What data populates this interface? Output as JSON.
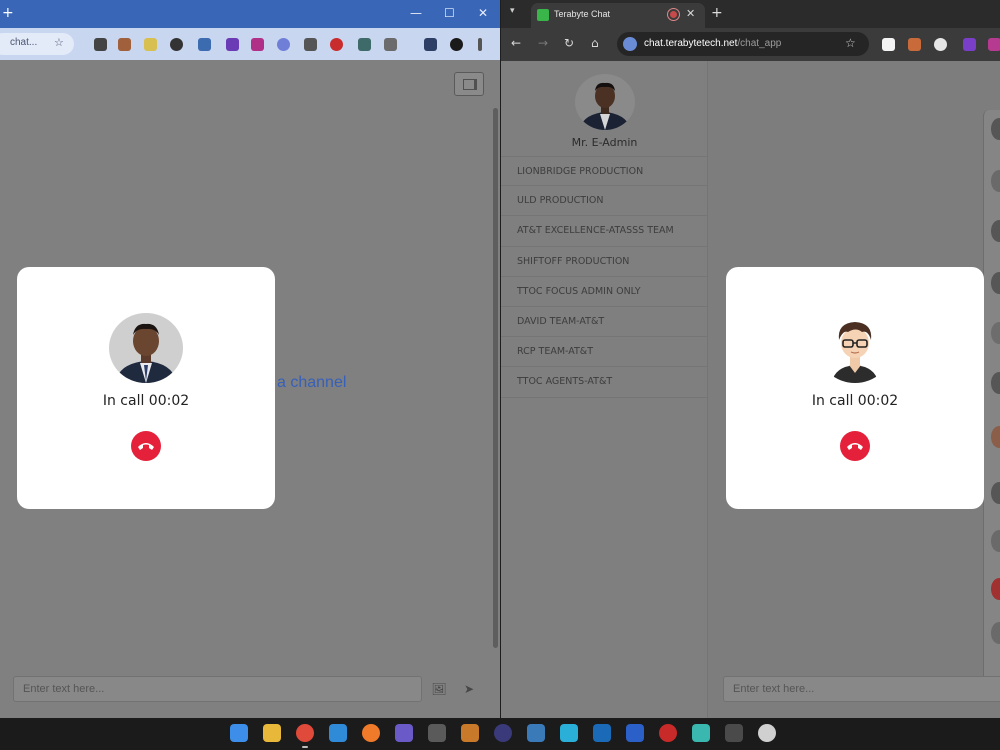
{
  "left_window": {
    "tab_new": "+",
    "window_controls": {
      "minimize": "—",
      "maximize": "☐",
      "close": "✕"
    },
    "omnibox_text": "chat...",
    "omnibox_star": "☆",
    "call": {
      "status": "In call 00:02"
    },
    "channel_hint": "a channel",
    "composer": {
      "placeholder": "Enter text here..."
    },
    "buttons": {
      "image": "🖼",
      "send": "➤"
    }
  },
  "right_window": {
    "menu_glyph": "▾",
    "tab": {
      "title": "Terabyte Chat",
      "close": "✕"
    },
    "new_tab": "+",
    "nav": {
      "back": "←",
      "forward": "→",
      "reload": "↻",
      "home": "⌂"
    },
    "url": {
      "host": "chat.terabytetech.net",
      "path": "/chat_app"
    },
    "omnibox_star": "☆",
    "admin_name": "Mr. E-Admin",
    "channels": [
      "LIONBRIDGE PRODUCTION",
      "ULD PRODUCTION",
      "AT&T EXCELLENCE-ATASSS TEAM",
      "SHIFTOFF PRODUCTION",
      "TTOC FOCUS ADMIN ONLY",
      "DAVID TEAM-AT&T",
      "RCP TEAM-AT&T",
      "TTOC AGENTS-AT&T"
    ],
    "call": {
      "status": "In call 00:02"
    },
    "composer": {
      "placeholder": "Enter text here..."
    }
  },
  "colors": {
    "hangup": "#e5203a",
    "link_blue": "#3760b8",
    "left_titlebar": "#3a66b8",
    "overlay_gray": "#808080"
  },
  "taskbar": {
    "icons": [
      "windows-start",
      "file-explorer",
      "chrome",
      "vscode",
      "firefox",
      "teams",
      "lock-app",
      "app-badge",
      "obs",
      "app-b",
      "app-c",
      "app-d",
      "css3",
      "app-red",
      "app-e",
      "terminal",
      "app-f"
    ]
  }
}
